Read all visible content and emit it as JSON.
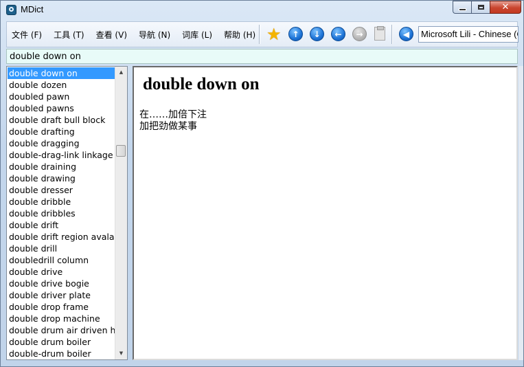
{
  "window": {
    "title": "MDict"
  },
  "menu": [
    {
      "label": "文件 (F)"
    },
    {
      "label": "工具 (T)"
    },
    {
      "label": "查看 (V)"
    },
    {
      "label": "导航 (N)"
    },
    {
      "label": "词库 (L)"
    },
    {
      "label": "帮助 (H)"
    }
  ],
  "toolbar": {
    "icons": [
      "star-icon",
      "up-arrow-icon",
      "down-arrow-icon",
      "back-arrow-icon",
      "forward-arrow-icon",
      "clipboard-icon",
      "speaker-icon"
    ],
    "voice": "Microsoft Lili - Chinese (China)"
  },
  "search": {
    "value": "double down on"
  },
  "word_list": {
    "selected_index": 0,
    "items": [
      "double down on",
      "double dozen",
      "doubled pawn",
      "doubled pawns",
      "double draft bull block",
      "double drafting",
      "double dragging",
      "double-drag-link linkage",
      "double draining",
      "double drawing",
      "double dresser",
      "double dribble",
      "double dribbles",
      "double drift",
      "double drift region avalanche",
      "double drill",
      "doubledrill column",
      "double drive",
      "double drive bogie",
      "double driver plate",
      "double drop frame",
      "double drop machine",
      "double drum air driven hoist",
      "double drum boiler",
      "double-drum boiler"
    ]
  },
  "entry": {
    "title": "double down on",
    "definitions": [
      "在……加倍下注",
      "加把劲做某事"
    ]
  },
  "colors": {
    "selection": "#3399ff",
    "search_bg": "#e8fbf8",
    "close_button": "#c9452e"
  }
}
